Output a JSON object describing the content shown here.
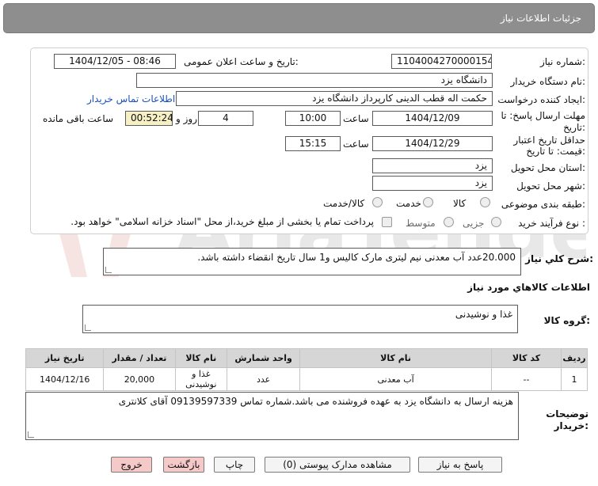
{
  "header": {
    "title": "جزئیات اطلاعات نیاز"
  },
  "form": {
    "need_number_label": "شماره نیاز:",
    "need_number": "1104004270000154",
    "announce_label": "تاریخ و ساعت اعلان عمومی:",
    "announce_value": "1404/12/05 - 08:46",
    "buyer_label": "نام دستگاه خریدار:",
    "buyer_value": "دانشگاه یزد",
    "creator_label": "ایجاد کننده درخواست:",
    "creator_value": "حکمت اله قطب الدینی کارپرداز دانشگاه یزد",
    "contact_link": "اطلاعات تماس خریدار",
    "deadline_label_1": "مهلت ارسال پاسخ: تا",
    "deadline_label_2": "تاریخ:",
    "deadline_date": "1404/12/09",
    "time_label": "ساعت",
    "deadline_time": "10:00",
    "days_value": "4",
    "days_label": "روز و",
    "remaining_time": "00:52:24",
    "remaining_label": "ساعت باقی مانده",
    "validity_label_1": "حداقل تاریخ اعتبار",
    "validity_label_2": "قیمت: تا تاریخ:",
    "validity_date": "1404/12/29",
    "validity_time": "15:15",
    "province_label": "استان محل تحویل:",
    "province_value": "یزد",
    "city_label": "شهر محل تحویل:",
    "city_value": "یزد",
    "category_label": "طبقه بندی موضوعی:",
    "category_options": [
      "کالا",
      "خدمت",
      "کالا/خدمت"
    ],
    "process_label": "نوع فرآیند خرید :",
    "process_options": [
      "جزیی",
      "متوسط"
    ],
    "payment_text": "پرداخت تمام یا بخشی از مبلغ خرید،از محل \"اسناد خزانه اسلامی\" خواهد بود."
  },
  "summary": {
    "label": "شرح کلي نياز:",
    "text": "20.000عدد آب معدنی نیم لیتری مارک کالیس و1 سال تاریخ انقضاء داشته باشد."
  },
  "goods": {
    "section_title": "اطلاعات کالاهاي مورد نياز",
    "group_label": "گروه کالا:",
    "group_value": "غذا و نوشیدنی"
  },
  "table": {
    "headers": [
      "ردیف",
      "کد کالا",
      "نام کالا",
      "واحد شمارش",
      "نام کالا",
      "تعداد / مقدار",
      "تاریخ نیاز"
    ],
    "row": [
      "1",
      "--",
      "آب معدنی",
      "عدد",
      "غذا و نوشیدنی",
      "20,000",
      "1404/12/16"
    ]
  },
  "notes": {
    "label_1": "توضیحات",
    "label_2": "خریدار:",
    "text": "هزینه ارسال به دانشگاه یزد به عهده فروشنده می باشد.شماره تماس 09139597339 آقای  کلانتری"
  },
  "buttons": {
    "reply": "پاسخ به نیاز",
    "attachments": "مشاهده مدارک پیوستی (0)",
    "print": "چاپ",
    "back": "بازگشت",
    "exit": "خروج"
  },
  "watermark": "AriaTender.neT",
  "colors": {
    "header_bg": "#8e8e8e",
    "table_header_bg": "#d6d6d6",
    "remaining_bg": "#f6f0c4",
    "exit_button_bg": "#f6c9c9",
    "link": "#1a4fbf"
  }
}
